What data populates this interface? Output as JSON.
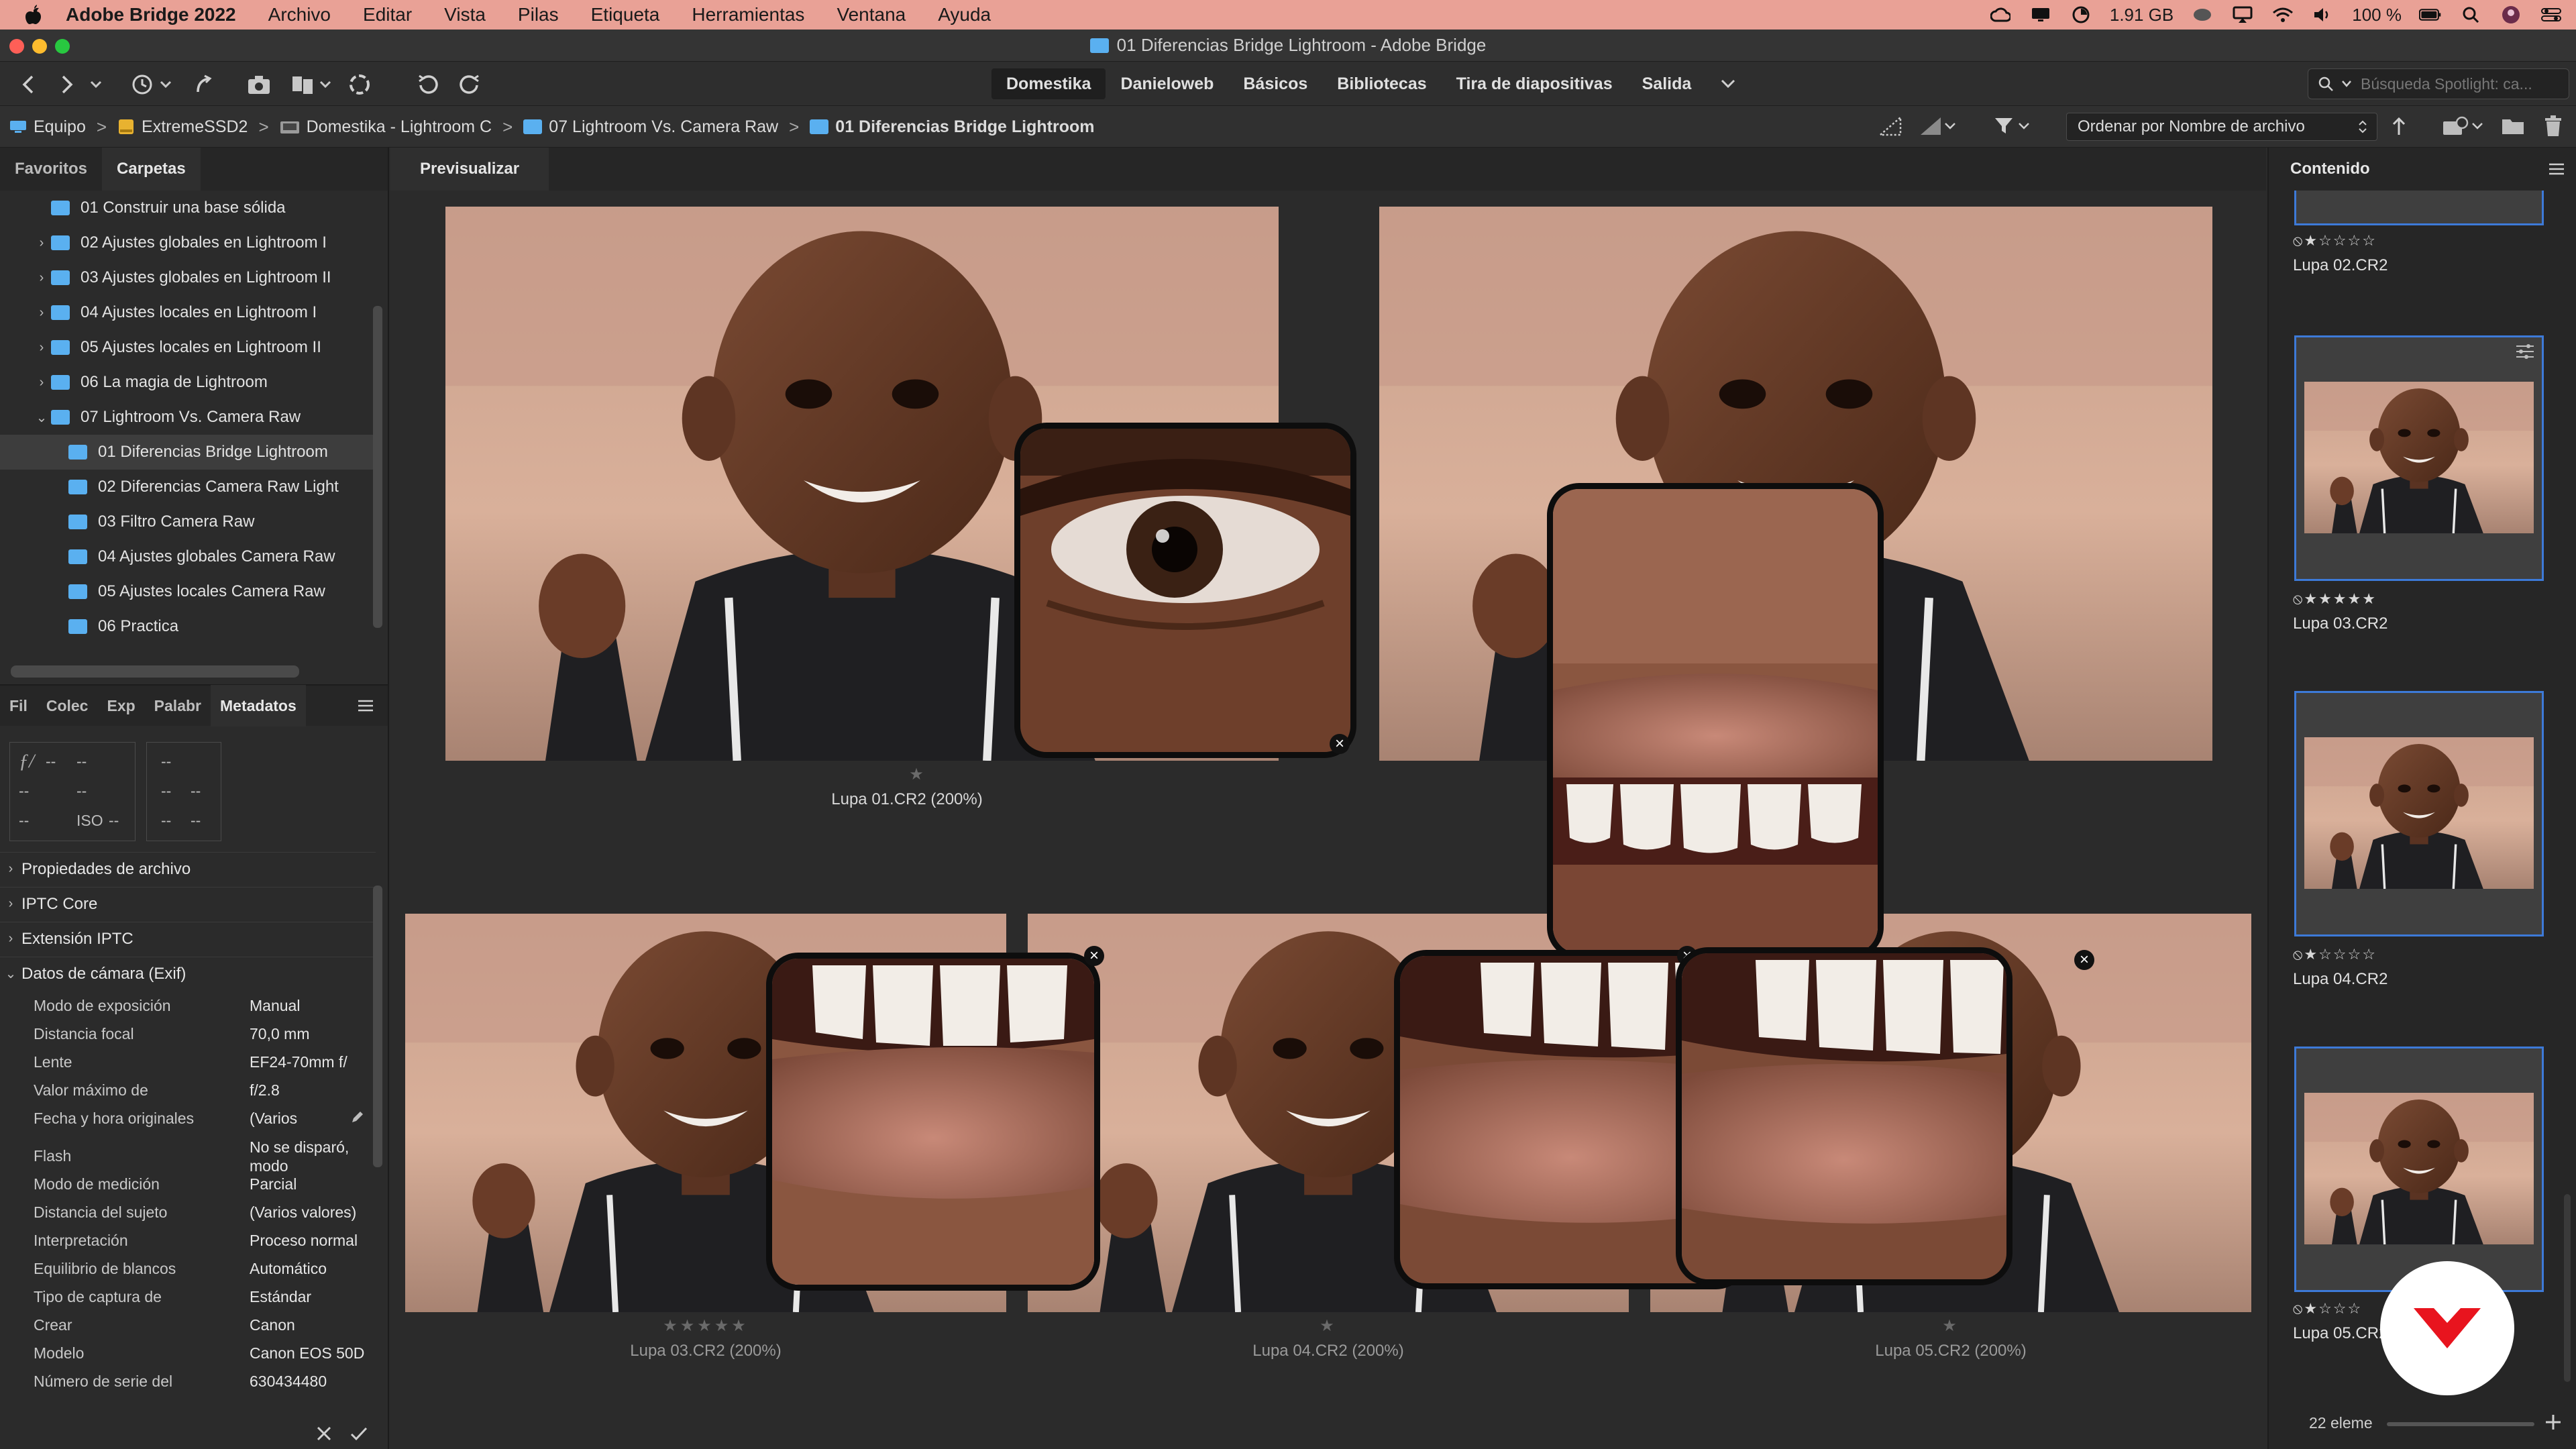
{
  "menubar": {
    "app": "Adobe Bridge 2022",
    "items": [
      "Archivo",
      "Editar",
      "Vista",
      "Pilas",
      "Etiqueta",
      "Herramientas",
      "Ventana",
      "Ayuda"
    ],
    "memory": "1.91 GB",
    "battery": "100 %"
  },
  "window": {
    "title": "01 Diferencias Bridge Lightroom - Adobe Bridge"
  },
  "toolbar": {
    "workspaces": [
      "Domestika",
      "Danieloweb",
      "Básicos",
      "Bibliotecas",
      "Tira de diapositivas",
      "Salida"
    ],
    "active_workspace": "Domestika",
    "search_placeholder": "Búsqueda Spotlight: ca..."
  },
  "path": {
    "crumbs": [
      "Equipo",
      "ExtremeSSD2",
      "Domestika - Lightroom C",
      "07 Lightroom Vs. Camera Raw",
      "01 Diferencias Bridge Lightroom"
    ],
    "sort_label": "Ordenar por Nombre de archivo"
  },
  "left_panel": {
    "tabs": [
      "Favoritos",
      "Carpetas"
    ],
    "active_tab": "Carpetas",
    "folders": [
      {
        "label": "01 Construir una base sólida",
        "level": 1,
        "expander": ""
      },
      {
        "label": "02 Ajustes globales en Lightroom I",
        "level": 1,
        "expander": ">"
      },
      {
        "label": "03 Ajustes globales en Lightroom II",
        "level": 1,
        "expander": ">"
      },
      {
        "label": "04 Ajustes locales en Lightroom I",
        "level": 1,
        "expander": ">"
      },
      {
        "label": "05 Ajustes locales en Lightroom II",
        "level": 1,
        "expander": ">"
      },
      {
        "label": "06 La magia de Lightroom",
        "level": 1,
        "expander": ">"
      },
      {
        "label": "07 Lightroom Vs. Camera Raw",
        "level": 1,
        "expander": "v"
      },
      {
        "label": "01 Diferencias Bridge Lightroom",
        "level": 2,
        "expander": "",
        "selected": true
      },
      {
        "label": "02 Diferencias Camera Raw Light",
        "level": 2,
        "expander": ""
      },
      {
        "label": "03 Filtro Camera Raw",
        "level": 2,
        "expander": ""
      },
      {
        "label": "04 Ajustes globales Camera Raw",
        "level": 2,
        "expander": ""
      },
      {
        "label": "05 Ajustes locales Camera Raw",
        "level": 2,
        "expander": ""
      },
      {
        "label": "06 Practica",
        "level": 2,
        "expander": ""
      }
    ],
    "meta_tabs": [
      "Fil",
      "Colec",
      "Exp",
      "Palabr",
      "Metadatos"
    ],
    "active_meta_tab": "Metadatos",
    "placard": {
      "aperture_symbol": "ƒ/",
      "iso_label": "ISO",
      "empty": "--"
    },
    "sections": [
      "Propiedades de archivo",
      "IPTC Core",
      "Extensión IPTC",
      "Datos de cámara (Exif)"
    ],
    "exif": [
      {
        "key": "Modo de exposición",
        "value": "Manual"
      },
      {
        "key": "Distancia focal",
        "value": "70,0 mm"
      },
      {
        "key": "Lente",
        "value": "EF24-70mm f/"
      },
      {
        "key": "Valor máximo de",
        "value": "f/2.8"
      },
      {
        "key": "Fecha y hora originales",
        "value": "(Varios"
      },
      {
        "key": "Flash",
        "value": "No se disparó, modo"
      },
      {
        "key": "Modo de medición",
        "value": "Parcial"
      },
      {
        "key": "Distancia del sujeto",
        "value": "(Varios valores)"
      },
      {
        "key": "Interpretación",
        "value": "Proceso normal"
      },
      {
        "key": "Equilibrio de blancos",
        "value": "Automático"
      },
      {
        "key": "Tipo de captura de",
        "value": "Estándar"
      },
      {
        "key": "Crear",
        "value": "Canon"
      },
      {
        "key": "Modelo",
        "value": "Canon EOS 50D"
      },
      {
        "key": "Número de serie del",
        "value": "630434480"
      }
    ]
  },
  "preview": {
    "tab": "Previsualizar",
    "captions": [
      "Lupa 01.CR2 (200%)",
      "Lupa 03.CR2 (200%)",
      "Lupa 04.CR2 (200%)",
      "Lupa 05.CR2 (200%)"
    ]
  },
  "right_panel": {
    "tab": "Contenido",
    "thumbs": [
      {
        "label": "Lupa 02.CR2",
        "rating_text": "⦸★☆☆☆☆",
        "rating": 1
      },
      {
        "label": "Lupa 03.CR2",
        "rating_text": "⦸★★★★★",
        "rating": 5
      },
      {
        "label": "Lupa 04.CR2",
        "rating_text": "⦸★☆☆☆☆",
        "rating": 1
      },
      {
        "label": "Lupa 05.CR2",
        "rating_text": "⦸★☆☆☆",
        "rating": 1
      }
    ],
    "count": "22 eleme"
  },
  "colors": {
    "menubar": "#e9a196",
    "selection_border": "#3d7ad8",
    "folder_icon": "#5ab0f0",
    "logo_red": "#e8141e"
  }
}
